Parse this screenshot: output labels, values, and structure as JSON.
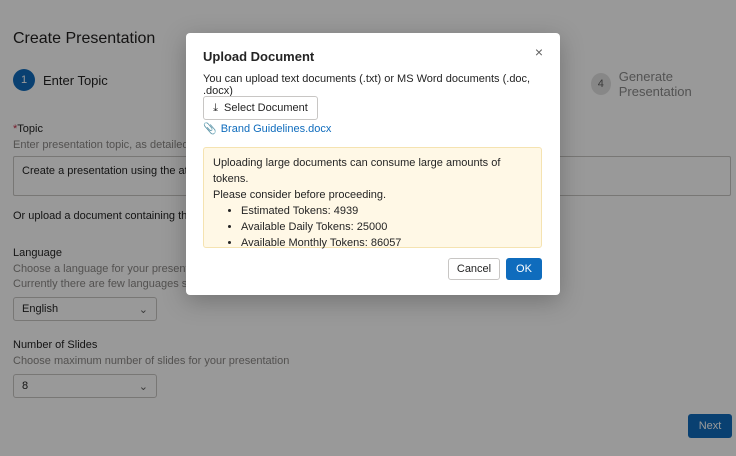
{
  "page": {
    "title": "Create Presentation",
    "steps": [
      {
        "number": "1",
        "label": "Enter Topic"
      },
      {
        "number": "4",
        "label": "Generate Presentation"
      }
    ],
    "topic": {
      "required_mark": "*",
      "label": "Topic",
      "hint": "Enter presentation topic, as detailed a",
      "value": "Create a presentation using the attac"
    },
    "upload_hint": "Or upload a document containing the c",
    "language": {
      "label": "Language",
      "hint1": "Choose a language for your presentatio",
      "hint2": "Currently there are few languages supp",
      "value": "English"
    },
    "slides": {
      "label": "Number of Slides",
      "hint": "Choose maximum number of slides for your presentation",
      "value": "8"
    },
    "next_label": "Next"
  },
  "dialog": {
    "title": "Upload Document",
    "subtitle": "You can upload text documents (.txt) or MS Word documents (.doc, .docx)",
    "select_label": "Select Document",
    "file_name": "Brand Guidelines.docx",
    "warning_line1": "Uploading large documents can consume large amounts of tokens.",
    "warning_line2": "Please consider before proceeding.",
    "stats": [
      "Estimated Tokens: 4939",
      "Available Daily Tokens: 25000",
      "Available Monthly Tokens: 86057"
    ],
    "cancel_label": "Cancel",
    "ok_label": "OK"
  },
  "icons": {
    "close": "close-icon",
    "upload": "upload-icon",
    "attachment": "paperclip-icon",
    "chevron": "chevron-down-icon"
  },
  "colors": {
    "accent": "#0f6cbd",
    "warning_bg": "#fff8e6",
    "required": "#c4314b"
  }
}
